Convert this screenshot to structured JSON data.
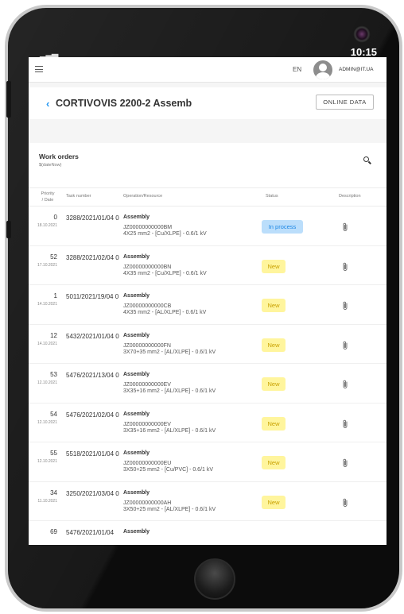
{
  "device": {
    "clock": "10:15",
    "signal_bars": "▁▂▃"
  },
  "topbar": {
    "language": "EN",
    "user": "ADMIN@IT.UA"
  },
  "header": {
    "back_symbol": "‹",
    "title": "CORTIVOVIS 2200-2 Assemb",
    "online_button": "ONLINE DATA"
  },
  "panel": {
    "title": "Work orders",
    "subtitle": "$(dateNow)"
  },
  "columns": {
    "priority_date": "Priority / Date",
    "task": "Task number",
    "operation": "Operation/Resource",
    "status": "Status",
    "description": "Description"
  },
  "colors": {
    "accent": "#2196f3",
    "in_process_bg": "#bbdefb",
    "new_bg": "#fff59d"
  },
  "rows": [
    {
      "priority": "0",
      "date": "18.10.2021",
      "task": "3288/2021/01/04 0",
      "operation": "Assembly",
      "code": "JZ00000000000BM",
      "spec": "4X25 mm2 - [Cu/XLPE] - 0.6/1 kV",
      "status": "In process",
      "status_type": "process"
    },
    {
      "priority": "52",
      "date": "17.10.2021",
      "task": "3288/2021/02/04 0",
      "operation": "Assembly",
      "code": "JZ00000000000BN",
      "spec": "4X35 mm2 - [Cu/XLPE] - 0.6/1 kV",
      "status": "New",
      "status_type": "new"
    },
    {
      "priority": "1",
      "date": "14.10.2021",
      "task": "5011/2021/19/04 0",
      "operation": "Assembly",
      "code": "JZ00000000000CB",
      "spec": "4X35 mm2 - [AL/XLPE] - 0.6/1 kV",
      "status": "New",
      "status_type": "new"
    },
    {
      "priority": "12",
      "date": "14.10.2021",
      "task": "5432/2021/01/04 0",
      "operation": "Assembly",
      "code": "JZ00000000000FN",
      "spec": "3X70+35 mm2 - [AL/XLPE] - 0.6/1 kV",
      "status": "New",
      "status_type": "new"
    },
    {
      "priority": "53",
      "date": "12.10.2021",
      "task": "5476/2021/13/04 0",
      "operation": "Assembly",
      "code": "JZ00000000000EV",
      "spec": "3X35+16 mm2 - [AL/XLPE] - 0.6/1 kV",
      "status": "New",
      "status_type": "new"
    },
    {
      "priority": "54",
      "date": "12.10.2021",
      "task": "5476/2021/02/04 0",
      "operation": "Assembly",
      "code": "JZ00000000000EV",
      "spec": "3X35+16 mm2 - [AL/XLPE] - 0.6/1 kV",
      "status": "New",
      "status_type": "new"
    },
    {
      "priority": "55",
      "date": "12.10.2021",
      "task": "5518/2021/01/04 0",
      "operation": "Assembly",
      "code": "JZ00000000000EU",
      "spec": "3X50+25 mm2 - [Cu/PVC] - 0.6/1 kV",
      "status": "New",
      "status_type": "new"
    },
    {
      "priority": "34",
      "date": "11.10.2021",
      "task": "3250/2021/03/04 0",
      "operation": "Assembly",
      "code": "JZ00000000000AH",
      "spec": "3X50+25 mm2 - [AL/XLPE] - 0.6/1 kV",
      "status": "New",
      "status_type": "new"
    },
    {
      "priority": "69",
      "date": "",
      "task": "5476/2021/01/04",
      "operation": "Assembly",
      "code": "",
      "spec": "",
      "status": "",
      "status_type": "partial"
    }
  ]
}
